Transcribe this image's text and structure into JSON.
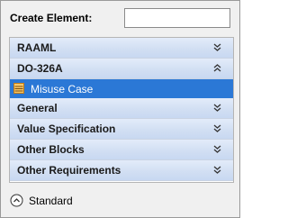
{
  "create": {
    "label": "Create Element:",
    "value": "",
    "placeholder": ""
  },
  "groups": [
    {
      "label": "RAAML",
      "state": "collapsed",
      "chevron": "chevron-double-down-icon"
    },
    {
      "label": "DO-326A",
      "state": "expanded",
      "chevron": "chevron-double-up-icon"
    },
    {
      "label": "General",
      "state": "collapsed",
      "chevron": "chevron-double-down-icon"
    },
    {
      "label": "Value Specification",
      "state": "collapsed",
      "chevron": "chevron-double-down-icon"
    },
    {
      "label": "Other Blocks",
      "state": "collapsed",
      "chevron": "chevron-double-down-icon"
    },
    {
      "label": "Other Requirements",
      "state": "collapsed",
      "chevron": "chevron-double-down-icon"
    }
  ],
  "selected_item": {
    "label": "Misuse Case",
    "icon": "misuse-case-icon",
    "selected": true
  },
  "footer": {
    "label": "Standard",
    "icon": "circle-chevron-up-icon"
  },
  "colors": {
    "selection": "#2b78d6",
    "header_top": "#e3ecfa",
    "header_bottom": "#c8d8f1",
    "icon_orange": "#e8a53b"
  }
}
